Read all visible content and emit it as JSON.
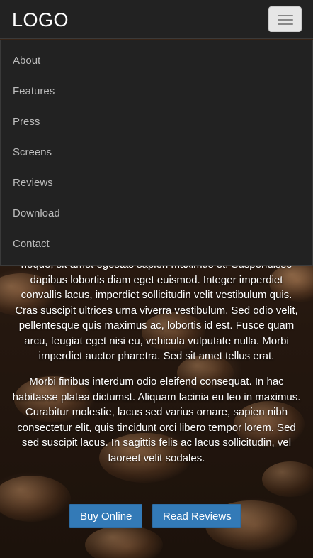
{
  "navbar": {
    "brand": "LOGO",
    "toggle_icon": "hamburger-menu-icon"
  },
  "menu": {
    "items": [
      {
        "label": "About"
      },
      {
        "label": "Features"
      },
      {
        "label": "Press"
      },
      {
        "label": "Screens"
      },
      {
        "label": "Reviews"
      },
      {
        "label": "Download"
      },
      {
        "label": "Contact"
      }
    ]
  },
  "content": {
    "paragraph_1": "neque, sit amet egestas sapien maximus et. Suspendisse dapibus lobortis diam eget euismod. Integer imperdiet convallis lacus, imperdiet sollicitudin velit vestibulum quis. Cras suscipit ultrices urna viverra vestibulum. Sed odio velit, pellentesque quis maximus ac, lobortis id est. Fusce quam arcu, feugiat eget nisi eu, vehicula vulputate nulla. Morbi imperdiet auctor pharetra. Sed sit amet tellus erat.",
    "paragraph_2": "Morbi finibus interdum odio eleifend consequat. In hac habitasse platea dictumst. Aliquam lacinia eu leo in maximus. Curabitur molestie, lacus sed varius ornare, sapien nibh consectetur elit, quis tincidunt orci libero tempor lorem. Sed sed suscipit lacus. In sagittis felis ac lacus sollicitudin, vel laoreet velit sodales."
  },
  "buttons": {
    "buy_online": "Buy Online",
    "read_reviews": "Read Reviews"
  },
  "colors": {
    "navbar_bg": "#222222",
    "menu_text": "#bdbdbd",
    "button_primary": "#337ab7"
  }
}
